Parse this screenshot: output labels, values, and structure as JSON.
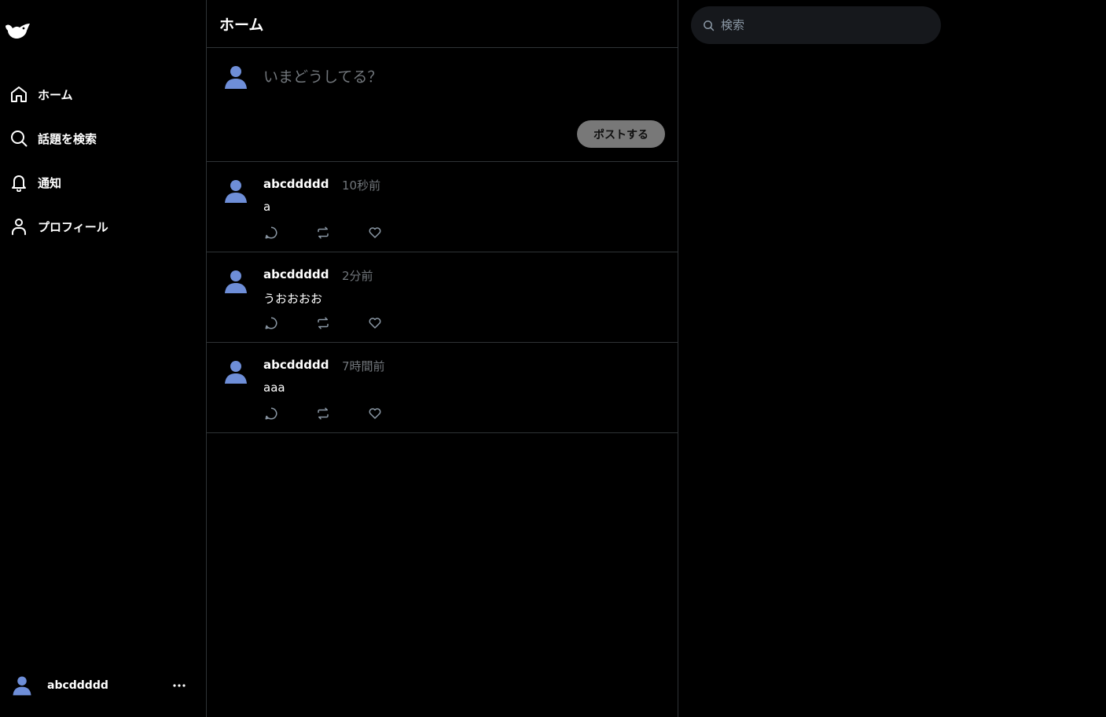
{
  "colors": {
    "background": "#000000",
    "border": "#2f3336",
    "muted_text": "#71767b",
    "avatar": "#6e8ed8",
    "post_button": "#787878",
    "search_bg": "#16181c"
  },
  "sidebar": {
    "logo_icon": "bird-logo-icon",
    "items": [
      {
        "label": "ホーム",
        "icon": "home-icon"
      },
      {
        "label": "話題を検索",
        "icon": "search-icon"
      },
      {
        "label": "通知",
        "icon": "bell-icon"
      },
      {
        "label": "プロフィール",
        "icon": "user-icon"
      }
    ],
    "account": {
      "name": "abcddddd",
      "more_icon": "more-dots-icon"
    }
  },
  "main": {
    "title": "ホーム",
    "composer": {
      "placeholder": "いまどうしてる？",
      "post_button": "ポストする"
    },
    "posts": [
      {
        "user": "abcddddd",
        "time": "10秒前",
        "text": "a"
      },
      {
        "user": "abcddddd",
        "time": "2分前",
        "text": "うおおおお"
      },
      {
        "user": "abcddddd",
        "time": "7時間前",
        "text": "aaa"
      }
    ]
  },
  "right": {
    "search": {
      "placeholder": "検索"
    }
  }
}
